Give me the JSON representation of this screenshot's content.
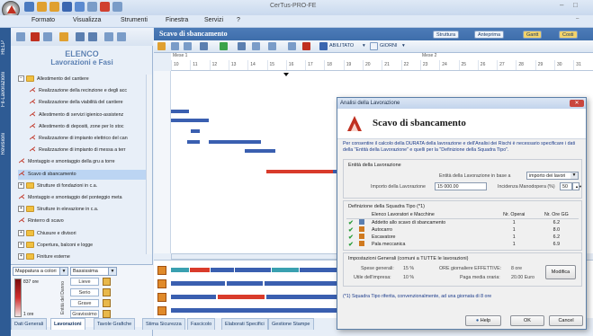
{
  "window": {
    "title": "CerTus-PRO-FE"
  },
  "menu": [
    "Formato",
    "Visualizza",
    "Strumenti",
    "Finestra",
    "Servizi",
    "?"
  ],
  "side_strip": [
    "HELP",
    "Fil-Lavorazioni",
    "Revisioni"
  ],
  "left_panel": {
    "title": "ELENCO",
    "subtitle": "Lavorazioni e Fasi",
    "tree": [
      {
        "label": "Allestimento del cantiere",
        "level": 0,
        "kind": "folder",
        "expander": "−"
      },
      {
        "label": "Realizzazione della recinzione e degli acc",
        "level": 1,
        "kind": "task"
      },
      {
        "label": "Realizzazione della viabilità del cantiere",
        "level": 1,
        "kind": "task"
      },
      {
        "label": "Allestimento di servizi igienico-assistenz",
        "level": 1,
        "kind": "task"
      },
      {
        "label": "Allestimento di depositi, zone per lo stoc",
        "level": 1,
        "kind": "task"
      },
      {
        "label": "Realizzazione di impianto elettrico del can",
        "level": 1,
        "kind": "task"
      },
      {
        "label": "Realizzazione di impianto di messa a terr",
        "level": 1,
        "kind": "task"
      },
      {
        "label": "Montaggio e smontaggio della gru a torre",
        "level": 0,
        "kind": "task"
      },
      {
        "label": "Scavo di sbancamento",
        "level": 0,
        "kind": "task",
        "selected": true
      },
      {
        "label": "Strutture di fondazioni in c.a.",
        "level": 0,
        "kind": "folder",
        "expander": "+"
      },
      {
        "label": "Montaggio e smontaggio del ponteggio meta",
        "level": 0,
        "kind": "task"
      },
      {
        "label": "Strutture in elevazione in c.a.",
        "level": 0,
        "kind": "folder",
        "expander": "+"
      },
      {
        "label": "Rinterro di scavo",
        "level": 0,
        "kind": "task"
      },
      {
        "label": "Chiusure e divisori",
        "level": 0,
        "kind": "folder",
        "expander": "+"
      },
      {
        "label": "Copertura, balconi e logge",
        "level": 0,
        "kind": "folder",
        "expander": "+"
      },
      {
        "label": "Finiture esterne",
        "level": 0,
        "kind": "folder",
        "expander": "+"
      }
    ],
    "legend": {
      "map_select": "Mappatura a colori",
      "level_select": "Bassissima",
      "max_label": "837 ore",
      "min_label": "1 ore",
      "axis_label": "Entità del Danno",
      "severities": [
        "Lieve",
        "Serio",
        "Grave",
        "Gravissimo"
      ]
    }
  },
  "tabs": [
    {
      "label": "Dati Generali",
      "active": false
    },
    {
      "label": "Lavorazioni",
      "active": true
    },
    {
      "label": "Tavole Grafiche",
      "active": false
    },
    {
      "label": "Stima Sicurezza",
      "active": false
    },
    {
      "label": "Fascicolo",
      "active": false
    },
    {
      "label": "Elaborati Specifici",
      "active": false
    },
    {
      "label": "Gestione Stampe",
      "active": false
    }
  ],
  "main": {
    "title": "Scavo di sbancamento",
    "header_buttons": [
      "Struttura",
      "Anteprima",
      "Gantt",
      "Costi"
    ],
    "toolbar": {
      "abilitato": "ABILITATO",
      "giorni": "GIORNI"
    },
    "timeline": {
      "months": [
        "Mese 1",
        "Mese 2"
      ],
      "days": [
        "10",
        "11",
        "12",
        "13",
        "14",
        "15",
        "16",
        "17",
        "18",
        "19",
        "20",
        "21",
        "22",
        "23",
        "24",
        "25",
        "26",
        "27",
        "28",
        "29",
        "30",
        "31"
      ]
    }
  },
  "colors": {
    "accent": "#2f5f9d",
    "task_bar": "#3a5fb0",
    "critical_bar": "#d93b2b"
  },
  "dialog": {
    "window_title": "Analisi della Lavorazione",
    "heading": "Scavo di sbancamento",
    "description": "Per consentire il calcolo della DURATA della lavorazione e dell'Analisi dei Rischi è necessario specificare i dati della \"Entità della Lavorazione\" e quelli per la \"Definizione della Squadra Tipo\".",
    "entita": {
      "section": "Entità della Lavorazione",
      "basis_label": "Entità della Lavorazione in base a",
      "basis_value": "importo dei lavori",
      "importo_label": "Importo della Lavorazione",
      "importo_value": "15 000.00",
      "incidenza_label": "Incidenza Manodopera (%)",
      "incidenza_value": "50"
    },
    "squadra": {
      "section": "Definizione della Squadra Tipo  (*1)",
      "headers": [
        "Elenco Lavoratori e Macchine",
        "Nr. Operai",
        "Nr. Ore GG"
      ],
      "rows": [
        {
          "name": "Addetto allo scavo di sbancamento",
          "operai": "1",
          "ore": "6.2",
          "icon": "worker-icon"
        },
        {
          "name": "Autocarro",
          "operai": "1",
          "ore": "8.0",
          "icon": "machine-icon"
        },
        {
          "name": "Escavatore",
          "operai": "1",
          "ore": "6.2",
          "icon": "machine-icon"
        },
        {
          "name": "Pala meccanica",
          "operai": "1",
          "ore": "6.9",
          "icon": "machine-icon"
        }
      ]
    },
    "impostazioni": {
      "section": "Impostazioni Generali   (comuni a TUTTE le lavorazioni)",
      "spese_label": "Spese generali:",
      "spese_value": "15 %",
      "utile_label": "Utile dell'impresa:",
      "utile_value": "10 %",
      "ore_label": "ORE giornaliere EFFETTIVE:",
      "ore_value": "8 ore",
      "paga_label": "Paga media oraria:",
      "paga_value": "20.00 Euro",
      "modifica": "Modifica"
    },
    "footnote": "(*1) Squadra Tipo riferita, convenzionalmente, ad una giornata di 8 ore",
    "buttons": {
      "help": "Help",
      "ok": "OK",
      "cancel": "Cancel"
    }
  }
}
